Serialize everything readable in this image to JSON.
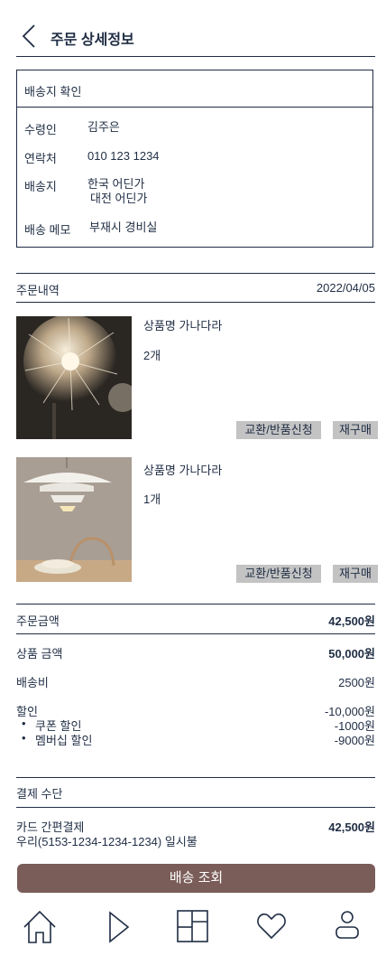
{
  "header": {
    "title": "주문 상세정보"
  },
  "shipping": {
    "heading": "배송지 확인",
    "recipient_label": "수령인",
    "recipient": "김주은",
    "contact_label": "연락처",
    "contact": "010 123 1234",
    "address_label": "배송지",
    "address_line1": "한국 어딘가",
    "address_line2": "대전 어딘가",
    "memo_label": "배송 메모",
    "memo": "부재시 경비실"
  },
  "order": {
    "label": "주문내역",
    "date": "2022/04/05",
    "items": [
      {
        "name": "상품명 가나다라",
        "qty": "2개",
        "exchange_label": "교환/반품신청",
        "reorder_label": "재구매"
      },
      {
        "name": "상품명 가나다라",
        "qty": "1개",
        "exchange_label": "교환/반품신청",
        "reorder_label": "재구매"
      }
    ]
  },
  "amount": {
    "total_label": "주문금액",
    "total": "42,500원",
    "product_label": "상품 금액",
    "product": "50,000원",
    "shipping_label": "배송비",
    "shipping": "2500원",
    "discount_label": "할인",
    "discount": "-10,000원",
    "coupon_label": "쿠폰 할인",
    "coupon": "-1000원",
    "member_label": "멤버십 할인",
    "member": "-9000원"
  },
  "payment": {
    "label": "결제 수단",
    "method": "카드 간편결제",
    "detail": "우리(5153-1234-1234-1234) 일시불",
    "amount": "42,500원"
  },
  "track_button": "배송 조회",
  "nav": [
    "home-icon",
    "play-icon",
    "layout-icon",
    "heart-icon",
    "profile-icon"
  ],
  "colors": {
    "text": "#1f2d44",
    "button": "#7a5c58",
    "tag": "#c3c3c3"
  }
}
